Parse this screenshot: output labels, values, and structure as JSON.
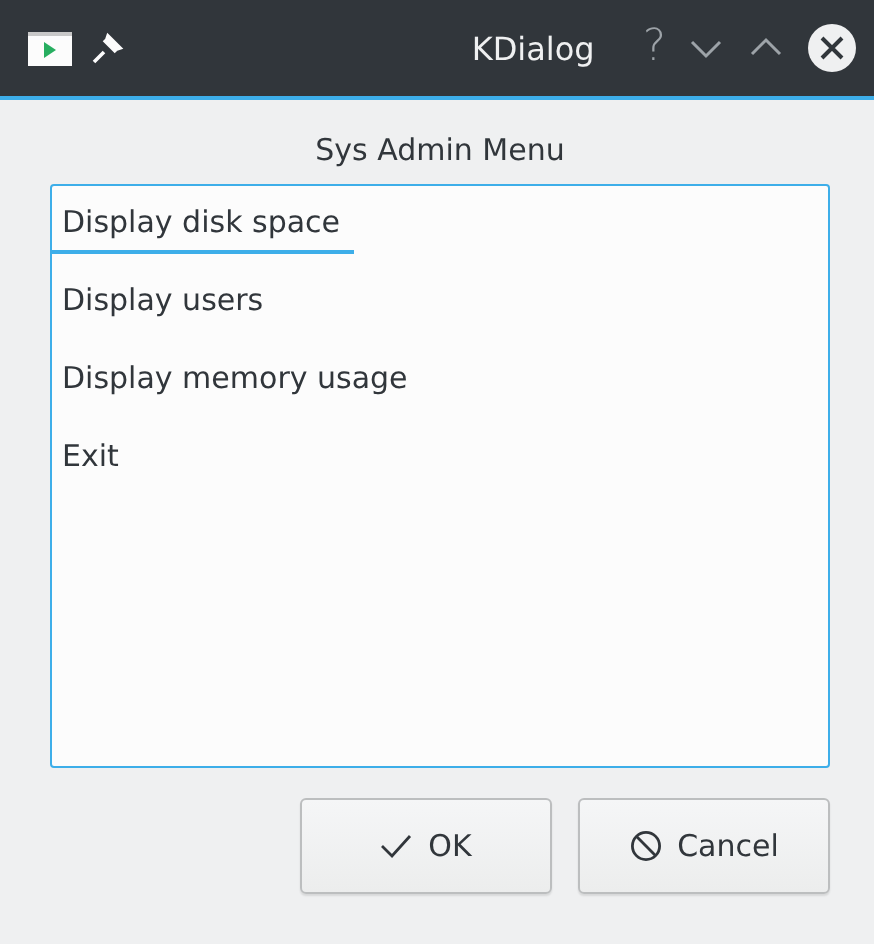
{
  "window": {
    "title": "KDialog",
    "controls": [
      "?"
    ]
  },
  "prompt": "Sys Admin Menu",
  "menu": [
    {
      "label": "Display disk space",
      "selected": true
    },
    {
      "label": "Display users",
      "selected": false
    },
    {
      "label": "Display memory usage",
      "selected": false
    },
    {
      "label": "Exit",
      "selected": false
    }
  ],
  "buttons": [
    {
      "kind": "ok",
      "label": "OK"
    },
    {
      "kind": "cancel",
      "label": "Cancel"
    }
  ]
}
